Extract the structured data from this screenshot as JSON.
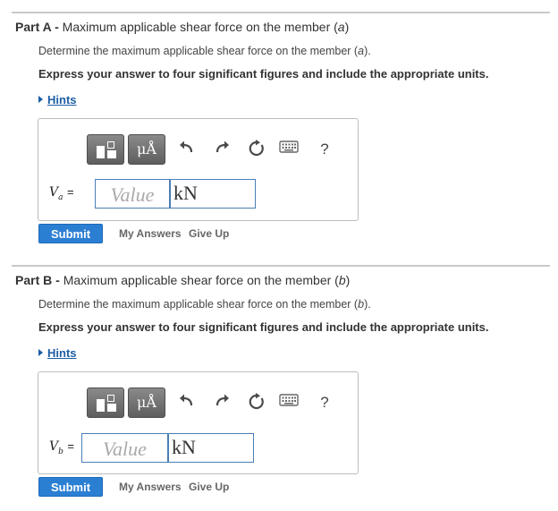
{
  "parts": [
    {
      "label": "Part A",
      "separator": " - ",
      "title_text": "Maximum applicable shear force on the member (",
      "title_var": "a",
      "title_close": ")",
      "prompt_text": "Determine the maximum applicable shear force on the member (",
      "prompt_var": "a",
      "prompt_close": ").",
      "instruction": "Express your answer to four significant figures and include the appropriate units.",
      "hints_label": "Hints",
      "variable": "V",
      "variable_sub": "a",
      "equals": "=",
      "value_placeholder": "Value",
      "unit_value": "kN",
      "toolbar": {
        "units_label": "μÅ",
        "help_label": "?"
      },
      "submit_label": "Submit",
      "my_answers_label": "My Answers",
      "give_up_label": "Give Up"
    },
    {
      "label": "Part B",
      "separator": " - ",
      "title_text": "Maximum applicable shear force on the member (",
      "title_var": "b",
      "title_close": ")",
      "prompt_text": "Determine the maximum applicable shear force on the member (",
      "prompt_var": "b",
      "prompt_close": ").",
      "instruction": "Express your answer to four significant figures and include the appropriate units.",
      "hints_label": "Hints",
      "variable": "V",
      "variable_sub": "b",
      "equals": "=",
      "value_placeholder": "Value",
      "unit_value": "kN",
      "toolbar": {
        "units_label": "μÅ",
        "help_label": "?"
      },
      "submit_label": "Submit",
      "my_answers_label": "My Answers",
      "give_up_label": "Give Up"
    }
  ],
  "icons": {
    "templates": "templates-icon",
    "units": "units-icon",
    "undo": "undo-icon",
    "redo": "redo-icon",
    "reset": "reset-icon",
    "keyboard": "keyboard-icon",
    "help": "help-icon",
    "hints": "triangle-right-icon"
  },
  "colors": {
    "submit": "#2b7fd3",
    "hints_link": "#1d5ea5",
    "input_border": "#4a7eb5",
    "toolbar_button": "#6f6f6f"
  }
}
